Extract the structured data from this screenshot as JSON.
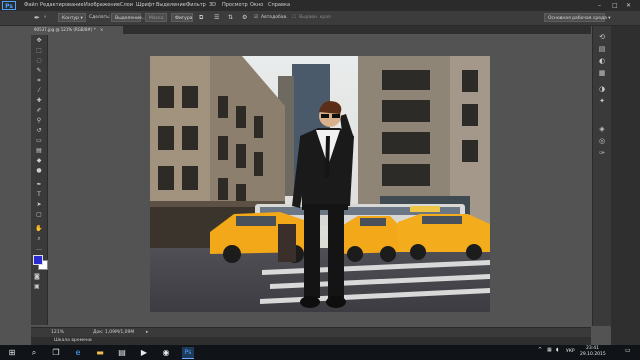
{
  "app": {
    "logo": "Ps"
  },
  "menu": [
    "Файл",
    "Редактирование",
    "Изображение",
    "Слои",
    "Шрифт",
    "Выделение",
    "Фильтр",
    "3D",
    "Просмотр",
    "Окно",
    "Справка"
  ],
  "options": {
    "tool_icon": "move-icon",
    "contour_label": "Контур",
    "make_label": "Сделать:",
    "selection_button": "Выделение...",
    "mask_button": "Маска",
    "shape_button": "Фигура",
    "autoadd_label": "Автодобав.",
    "align_label": "Выравн. края",
    "workspace_select": "Основная рабочая среда"
  },
  "document": {
    "tab_title": "90537.jpg @ 121% (RGB/8#) *"
  },
  "swatches": {
    "foreground": "#2b2bd0",
    "background": "#ffffff"
  },
  "status": {
    "zoom": "121%",
    "doc_size": "Док: 1,09M/1,09M",
    "timeline_label": "Шкала времени"
  },
  "taskbar": {
    "language": "УКР",
    "time": "23:41",
    "date": "29.10.2015",
    "apps": [
      "start-icon",
      "search-icon",
      "task-view-icon",
      "edge-icon",
      "explorer-icon",
      "store-icon",
      "media-icon",
      "chrome-icon",
      "photoshop-icon"
    ]
  }
}
